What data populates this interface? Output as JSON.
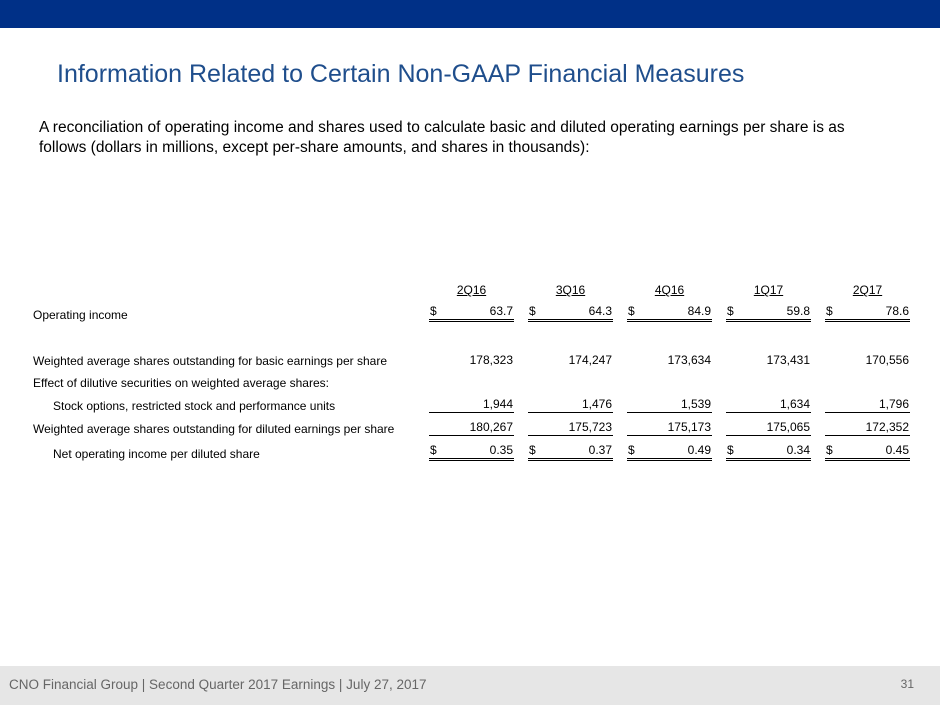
{
  "title": "Information Related to Certain Non-GAAP Financial Measures",
  "intro": "A reconciliation of operating income and shares used to calculate basic and diluted operating earnings per share is as follows (dollars in millions, except per-share amounts, and shares in thousands):",
  "table": {
    "periods": [
      "2Q16",
      "3Q16",
      "4Q16",
      "1Q17",
      "2Q17"
    ],
    "rows": {
      "operating_income": {
        "label": "Operating income",
        "currency": "$",
        "values": [
          "63.7",
          "64.3",
          "84.9",
          "59.8",
          "78.6"
        ]
      },
      "basic_shares": {
        "label": "Weighted average shares outstanding for basic earnings per share",
        "values": [
          "178,323",
          "174,247",
          "173,634",
          "173,431",
          "170,556"
        ]
      },
      "dilutive_effect": {
        "label": "Effect of dilutive securities on weighted average shares:"
      },
      "stock_options": {
        "label": "Stock options, restricted stock and performance units",
        "values": [
          "1,944",
          "1,476",
          "1,539",
          "1,634",
          "1,796"
        ]
      },
      "diluted_shares": {
        "label": "Weighted average shares outstanding for diluted earnings per share",
        "values": [
          "180,267",
          "175,723",
          "175,173",
          "175,065",
          "172,352"
        ]
      },
      "eps": {
        "label": "Net operating income per diluted share",
        "currency": "$",
        "values": [
          "0.35",
          "0.37",
          "0.49",
          "0.34",
          "0.45"
        ]
      }
    }
  },
  "footer": {
    "text": "CNO Financial Group | Second Quarter 2017 Earnings | July 27, 2017",
    "page": "31"
  },
  "colors": {
    "top_bar": "#003087",
    "title": "#1f4e8c",
    "footer_bg": "#e6e6e6",
    "footer_text": "#666666"
  }
}
